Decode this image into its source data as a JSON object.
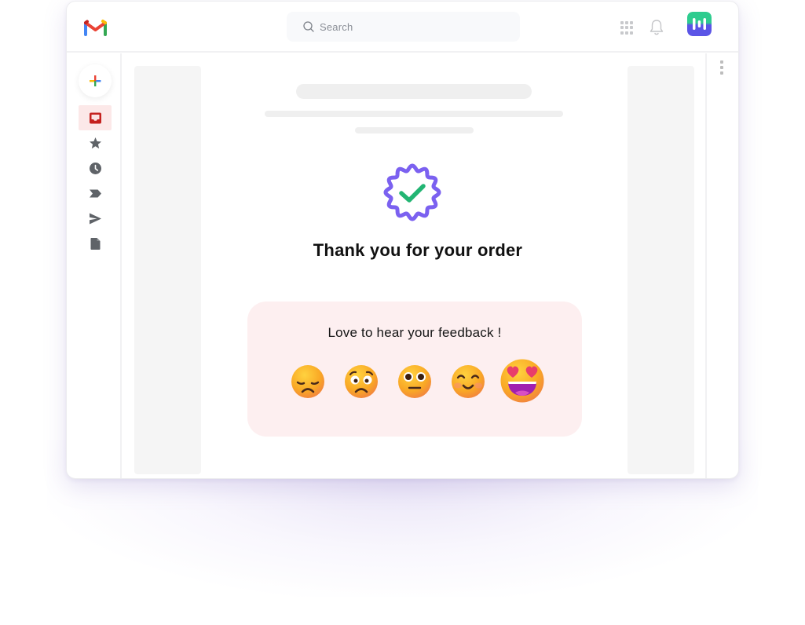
{
  "app": {
    "name": "Gmail",
    "brand_colors": {
      "gmail_red": "#EA4335",
      "gmail_blue": "#4285F4",
      "gmail_green": "#34A853",
      "gmail_yellow": "#FBBC04",
      "brand_green": "#2ECC8F",
      "brand_purple": "#5B55E6"
    }
  },
  "topbar": {
    "logo_icon": "gmail-logo-icon",
    "search": {
      "placeholder": "Search",
      "icon": "search-icon"
    },
    "icons": [
      "apps-grid-icon",
      "bell-icon",
      "brand-logo-icon"
    ]
  },
  "sidebar": {
    "compose_icon": "plus-icon",
    "items": [
      {
        "name": "inbox",
        "icon": "inbox-icon",
        "active": true,
        "color": "#C5221F"
      },
      {
        "name": "starred",
        "icon": "star-icon",
        "active": false
      },
      {
        "name": "snoozed",
        "icon": "clock-icon",
        "active": false
      },
      {
        "name": "important",
        "icon": "label-icon",
        "active": false
      },
      {
        "name": "sent",
        "icon": "send-icon",
        "active": false
      },
      {
        "name": "drafts",
        "icon": "file-icon",
        "active": false
      }
    ]
  },
  "right_rail": {
    "icon": "more-vertical-icon"
  },
  "email": {
    "badge_icon": "verified-check-badge-icon",
    "badge_colors": {
      "outline": "#7B61F0",
      "check": "#22B573"
    },
    "title": "Thank you for your order",
    "feedback": {
      "prompt": "Love to hear your feedback !",
      "background": "#FDEFF0",
      "options": [
        {
          "label": "disappointed",
          "icon": "disappointed-face-icon"
        },
        {
          "label": "worried",
          "icon": "worried-face-icon"
        },
        {
          "label": "neutral",
          "icon": "neutral-face-icon"
        },
        {
          "label": "happy",
          "icon": "smiling-face-icon"
        },
        {
          "label": "love",
          "icon": "heart-eyes-face-icon"
        }
      ]
    }
  }
}
